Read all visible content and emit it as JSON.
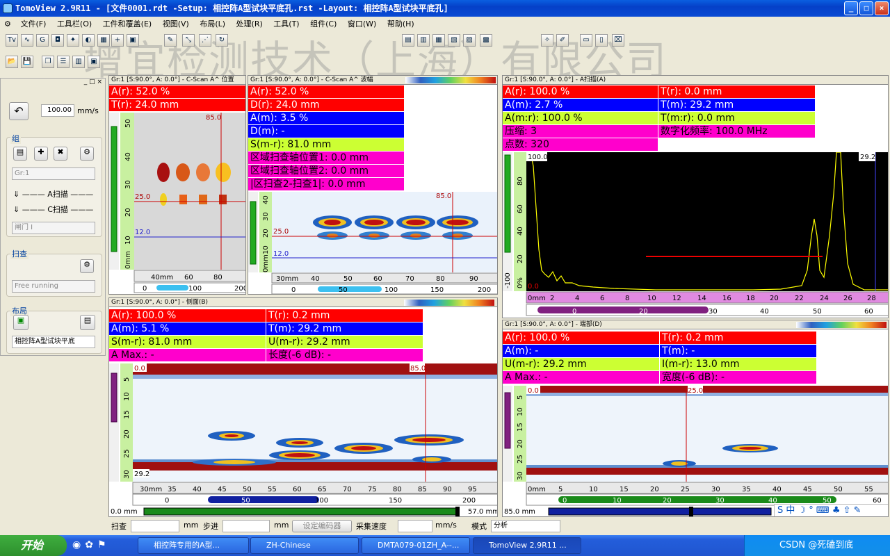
{
  "window": {
    "title": "TomoView 2.9R11 - [文件0001.rdt -Setup: 相控阵A型试块平底孔.rst -Layout: 相控阵A型试块平底孔]",
    "min": "_",
    "max": "□",
    "close": "×"
  },
  "menu": [
    "文件(F)",
    "工具栏(O)",
    "工件和覆盖(E)",
    "视图(V)",
    "布局(L)",
    "处理(R)",
    "工具(T)",
    "组件(C)",
    "窗口(W)",
    "帮助(H)"
  ],
  "watermark": "增宜检测技术（上海）有限公司",
  "side": {
    "velocity": "100.00",
    "velocity_unit": "mm/s",
    "group_title": "组",
    "group_select": "Gr:1",
    "ascan_label": "A扫描",
    "cscan_label": "C扫描",
    "gate_select": "闸门 I",
    "scan_title": "扫查",
    "scan_mode": "Free running",
    "layout_title": "布局",
    "layout_select": "相控阵A型试块平底"
  },
  "cscan_pos": {
    "title": "Gr:1 [S:90.0°, A: 0.0°] - C-Scan A^ 位置",
    "r1": "A(r): 52.0 %",
    "r2": "T(r): 24.0 mm",
    "cursor_x": "85.0",
    "cursor_y": "25.0",
    "gate_line": "12.0",
    "yticks": [
      "50",
      "40",
      "30",
      "20",
      "10",
      "0mm"
    ],
    "xticks": [
      "40mm",
      "60",
      "80"
    ],
    "scroll": [
      "0",
      "100",
      "200"
    ]
  },
  "cscan_amp": {
    "title": "Gr:1 [S:90.0°, A: 0.0°] - C-Scan A^ 波幅",
    "r1": "A(r): 52.0 %",
    "r2": "D(r): 24.0 mm",
    "r3": "A(m): 3.5 %",
    "r4": "D(m): -",
    "r5": "S(m-r): 81.0 mm",
    "r6": "区域扫查轴位置1: 0.0 mm",
    "r7": "区域扫查轴位置2: 0.0 mm",
    "r8": "|区扫查2-扫查1|: 0.0 mm",
    "cursor_x": "85.0",
    "cursor_y": "25.0",
    "gate_line": "12.0",
    "yticks": [
      "40",
      "30",
      "20",
      "10",
      "0mm"
    ],
    "xticks": [
      "30mm",
      "40",
      "50",
      "60",
      "70",
      "80",
      "90"
    ],
    "scroll": [
      "0",
      "50",
      "100",
      "150",
      "200"
    ]
  },
  "ascan": {
    "title": "Gr:1 [S:90.0°, A: 0.0°] - A扫描(A)",
    "c1": "A(r): 100.0 %",
    "c2": "T(r): 0.0 mm",
    "c3": "A(m): 2.7 %",
    "c4": "T(m): 29.2 mm",
    "c5": "A(m:r): 100.0 %",
    "c6": "T(m:r): 0.0 mm",
    "c7": "压缩: 3",
    "c8": "数字化频率: 100.0 MHz",
    "c9": "点数: 320",
    "top_label": "100.0",
    "right_label": "29.2",
    "bottom_label": "0.0",
    "yticks": [
      "80",
      "60",
      "40",
      "20",
      "0%",
      "-100"
    ],
    "xticks": [
      "0mm",
      "2",
      "4",
      "6",
      "8",
      "10",
      "12",
      "14",
      "16",
      "18",
      "20",
      "22",
      "24",
      "26",
      "28"
    ],
    "scroll": [
      "0",
      "20",
      "30",
      "40",
      "50",
      "60"
    ]
  },
  "bscan": {
    "title": "Gr:1 [S:90.0°, A: 0.0°] - 侧面(B)",
    "c1": "A(r): 100.0 %",
    "c2": "T(r): 0.2 mm",
    "c3": "A(m): 5.1 %",
    "c4": "T(m): 29.2 mm",
    "c5": "S(m-r): 81.0 mm",
    "c6": "U(m-r): 29.2 mm",
    "c7": "A Max.: -",
    "c8": "长度(-6 dB): -",
    "top_label": "0.0",
    "cursor_x": "85.0",
    "bottom_label": "29.2",
    "yticks": [
      "5",
      "10",
      "15",
      "20",
      "25",
      "30"
    ],
    "xticks": [
      "30mm",
      "35",
      "40",
      "45",
      "50",
      "55",
      "60",
      "65",
      "70",
      "75",
      "80",
      "85",
      "90",
      "95"
    ],
    "scroll": [
      "0",
      "50",
      "100",
      "150",
      "200"
    ],
    "range_lo": "0.0 mm",
    "range_hi": "57.0 mm"
  },
  "dscan": {
    "title": "Gr:1 [S:90.0°, A: 0.0°] - 端部(D)",
    "c1": "A(r): 100.0 %",
    "c2": "T(r): 0.2 mm",
    "c3": "A(m): -",
    "c4": "T(m): -",
    "c5": "U(m-r): 29.2 mm",
    "c6": "I(m-r): 13.0 mm",
    "c7": "A Max.: -",
    "c8": "宽度(-6 dB): -",
    "top_label": "0.0",
    "cursor_x": "25.0",
    "yticks": [
      "5",
      "10",
      "15",
      "20",
      "25",
      "30"
    ],
    "xticks": [
      "0mm",
      "5",
      "10",
      "15",
      "20",
      "25",
      "30",
      "35",
      "40",
      "45",
      "50",
      "55"
    ],
    "scroll": [
      "0",
      "10",
      "20",
      "30",
      "40",
      "50",
      "60"
    ],
    "range_lo": "85.0 mm"
  },
  "status": {
    "scan_label": "扫查",
    "unit1": "mm",
    "step_label": "步进",
    "unit2": "mm",
    "encoder_btn": "设定编码器",
    "speed_label": "采集速度",
    "unit3": "mm/s",
    "mode_label": "模式",
    "mode_value": "分析"
  },
  "taskbar": {
    "start": "开始",
    "tasks": [
      "相控阵专用的A型...",
      "ZH-Chinese",
      "DMTA079-01ZH_A--...",
      "TomoView 2.9R11 ..."
    ],
    "tray": "CSDN @死磕到底"
  }
}
